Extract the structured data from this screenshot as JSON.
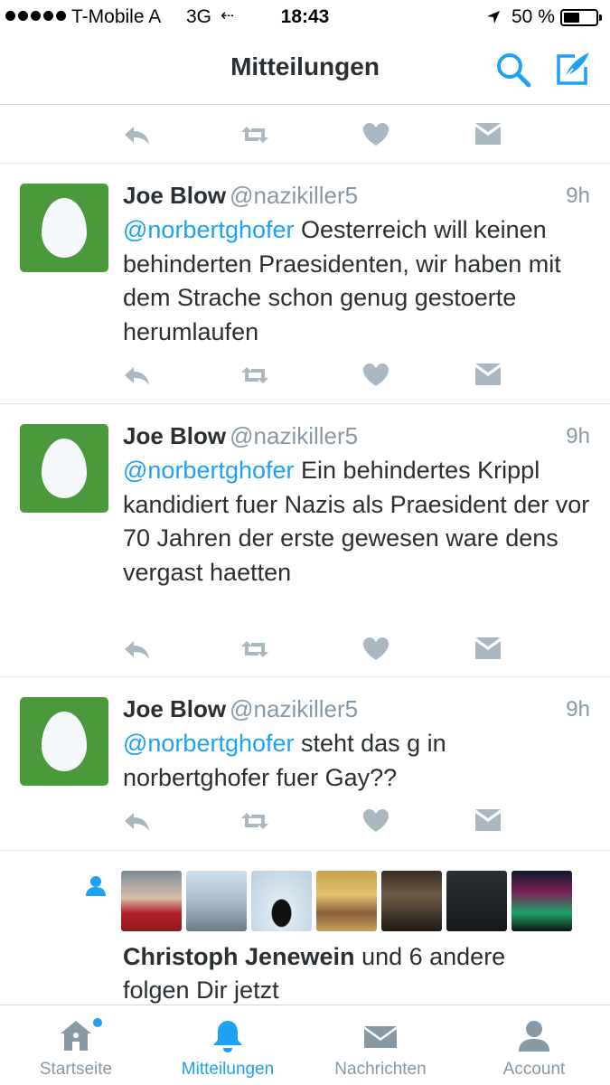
{
  "status_bar": {
    "carrier": "T-Mobile A",
    "network": "3G",
    "time": "18:43",
    "battery": "50 %",
    "battery_level": 0.5
  },
  "header": {
    "title": "Mitteilungen",
    "search_icon": "search-icon",
    "compose_icon": "compose-icon"
  },
  "colors": {
    "accent": "#1da1f2",
    "muted": "#8899a6",
    "text": "#292f33",
    "avatar_bg": "#4a9a3b"
  },
  "tweets": [
    {
      "name": "Joe Blow",
      "handle": "@nazikiller5",
      "time": "9h",
      "mention": "@norbertghofer",
      "text": "Oesterreich will keinen behinderten Praesidenten, wir haben mit dem Strache schon genug gestoerte herumlaufen"
    },
    {
      "name": "Joe Blow",
      "handle": "@nazikiller5",
      "time": "9h",
      "mention": "@norbertghofer",
      "text": "Ein behindertes Krippl kandidiert fuer Nazis als Praesident der vor 70 Jahren der erste gewesen ware dens vergast haetten"
    },
    {
      "name": "Joe Blow",
      "handle": "@nazikiller5",
      "time": "9h",
      "mention": "@norbertghofer",
      "text": "steht das g in norbertghofer fuer Gay??"
    }
  ],
  "follow_notification": {
    "name": "Christoph Jenewein",
    "rest": "und 6 andere folgen Dir jetzt"
  },
  "tabs": [
    {
      "label": "Startseite",
      "icon": "home-icon"
    },
    {
      "label": "Mitteilungen",
      "icon": "bell-icon"
    },
    {
      "label": "Nachrichten",
      "icon": "envelope-icon"
    },
    {
      "label": "Account",
      "icon": "person-icon"
    }
  ]
}
